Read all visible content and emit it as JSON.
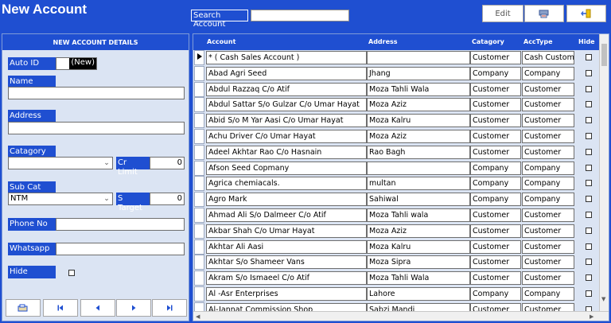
{
  "window": {
    "title": "New Account"
  },
  "search": {
    "label": "Search Account",
    "value": ""
  },
  "toolbar": {
    "edit_label": "Edit"
  },
  "form": {
    "header": "NEW ACCOUNT DETAILS",
    "auto_id_label": "Auto ID",
    "auto_id_value": "(New)",
    "name_label": "Name",
    "name_value": "",
    "address_label": "Address",
    "address_value": "",
    "catagory_label": "Catagory",
    "catagory_value": "",
    "cr_limit_label": "Cr Limit",
    "cr_limit_value": "0",
    "sub_cat_label": "Sub Cat",
    "sub_cat_value": "NTM",
    "s_target_label": "S Target",
    "s_target_value": "0",
    "phone_label": "Phone No",
    "phone_value": "",
    "whatsapp_label": "Whatsapp",
    "whatsapp_value": "",
    "hide_label": "Hide"
  },
  "grid": {
    "columns": {
      "account": "Account",
      "address": "Address",
      "catagory": "Catagory",
      "acctype": "AccType",
      "hide": "Hide"
    },
    "rows": [
      {
        "account": "* ( Cash Sales Account )",
        "address": "",
        "catagory": "Customer",
        "acctype": "Cash Customer"
      },
      {
        "account": "Abad Agri Seed",
        "address": "Jhang",
        "catagory": "Company",
        "acctype": "Company"
      },
      {
        "account": "Abdul Razzaq C/o Atif",
        "address": "Moza Tahli Wala",
        "catagory": "Customer",
        "acctype": "Customer"
      },
      {
        "account": "Abdul Sattar S/o Gulzar C/o Umar Hayat",
        "address": "Moza Aziz",
        "catagory": "Customer",
        "acctype": "Customer"
      },
      {
        "account": "Abid S/o M Yar Aasi C/o Umar Hayat",
        "address": "Moza Kalru",
        "catagory": "Customer",
        "acctype": "Customer"
      },
      {
        "account": "Achu Driver C/o Umar Hayat",
        "address": "Moza Aziz",
        "catagory": "Customer",
        "acctype": "Customer"
      },
      {
        "account": "Adeel Akhtar Rao C/o Hasnain",
        "address": "Rao Bagh",
        "catagory": "Customer",
        "acctype": "Customer"
      },
      {
        "account": "Afson Seed Copmany",
        "address": "",
        "catagory": "Company",
        "acctype": "Company"
      },
      {
        "account": "Agrica chemiacals.",
        "address": "multan",
        "catagory": "Company",
        "acctype": "Company"
      },
      {
        "account": "Agro Mark",
        "address": "Sahiwal",
        "catagory": "Company",
        "acctype": "Company"
      },
      {
        "account": "Ahmad Ali S/o Dalmeer C/o Atif",
        "address": "Moza Tahli wala",
        "catagory": "Customer",
        "acctype": "Customer"
      },
      {
        "account": "Akbar Shah C/o Umar Hayat",
        "address": "Moza Aziz",
        "catagory": "Customer",
        "acctype": "Customer"
      },
      {
        "account": "Akhtar Ali Aasi",
        "address": "Moza Kalru",
        "catagory": "Customer",
        "acctype": "Customer"
      },
      {
        "account": "Akhtar S/o Shameer Vans",
        "address": "Moza Sipra",
        "catagory": "Customer",
        "acctype": "Customer"
      },
      {
        "account": "Akram S/o Ismaeel C/o Atif",
        "address": "Moza Tahli Wala",
        "catagory": "Customer",
        "acctype": "Customer"
      },
      {
        "account": "Al -Asr Enterprises",
        "address": "Lahore",
        "catagory": "Company",
        "acctype": "Company"
      },
      {
        "account": "Al-Jannat Commission Shop",
        "address": "Sabzi Mandi",
        "catagory": "Customer",
        "acctype": "Customer"
      }
    ]
  },
  "icons": {
    "report": "report-icon",
    "exit": "exit-icon",
    "new_record": "new-record-icon",
    "first": "first-record-icon",
    "prev": "previous-record-icon",
    "next": "next-record-icon",
    "last": "last-record-icon"
  }
}
